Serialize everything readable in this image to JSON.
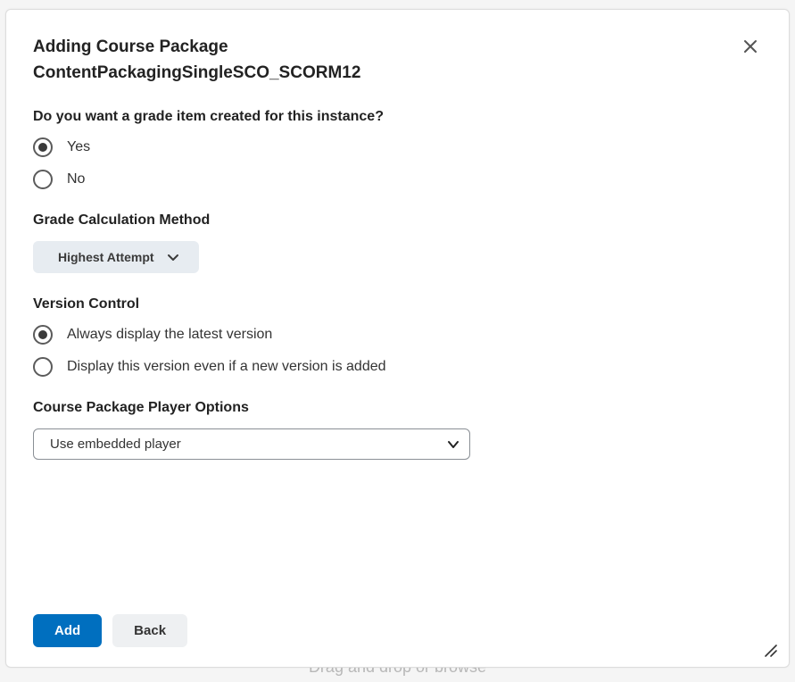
{
  "backdrop": {
    "hint": "Drag and drop or browse"
  },
  "modal": {
    "title_line1": "Adding Course Package",
    "title_line2": "ContentPackagingSingleSCO_SCORM12"
  },
  "grade_item": {
    "question": "Do you want a grade item created for this instance?",
    "options": {
      "yes": "Yes",
      "no": "No"
    },
    "selected": "yes"
  },
  "grade_calc": {
    "label": "Grade Calculation Method",
    "selected": "Highest Attempt"
  },
  "version_control": {
    "label": "Version Control",
    "options": {
      "latest": "Always display the latest version",
      "fixed": "Display this version even if a new version is added"
    },
    "selected": "latest"
  },
  "player_options": {
    "label": "Course Package Player Options",
    "selected": "Use embedded player"
  },
  "footer": {
    "add": "Add",
    "back": "Back"
  }
}
